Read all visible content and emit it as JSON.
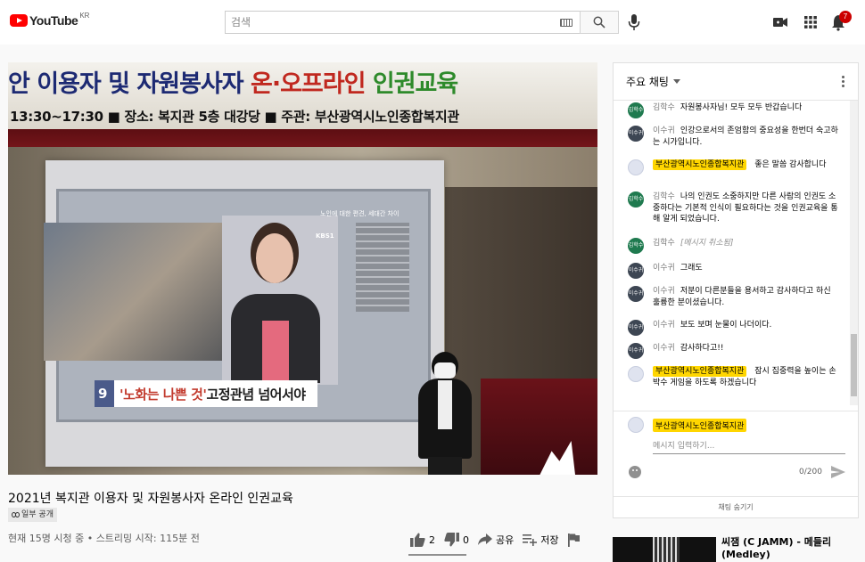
{
  "header": {
    "logo_text": "YouTube",
    "region": "KR",
    "search_placeholder": "검색",
    "notification_count": "7"
  },
  "video": {
    "banner": {
      "title_prefix": "안 이용자 및 자원봉사자 ",
      "title_red": "온·오프라인 ",
      "title_green": "인권교육",
      "subtitle": "13:30~17:30    ■ 장소: 복지관 5층 대강당    ■ 주관: 부산광역시노인종합복지관"
    },
    "tv": {
      "caption": "노인에 대한 편견, 세대간 차이",
      "channel": "KBS1",
      "lower_third_num": "9",
      "lower_third_quote": "'노화는 나쁜 것'",
      "lower_third_rest": " 고정관념 넘어서야"
    },
    "title": "2021년 복지관 이용자 및 자원봉사자 온라인 인권교육",
    "privacy": "일부 공개",
    "meta": "현재 15명 시청 중 • 스트리밍 시작: 115분 전",
    "likes": "2",
    "dislikes": "0",
    "share": "공유",
    "save": "저장",
    "like_ratio": 1.0
  },
  "chat": {
    "header": "주요 채팅",
    "messages": [
      {
        "avatar": "김학수",
        "author": "김학수",
        "text": "자원봉사자님! 모두 모두 반갑습니다"
      },
      {
        "avatar": "이수귀",
        "author": "이수귀",
        "text": "인강으로서의 존엄함의 중요성을 한번더 숙고하는 시가입니다."
      },
      {
        "avatar": "",
        "author": "부산광역시노인종합복지관",
        "text": "좋은 말씀 감사합니다"
      },
      {
        "avatar": "김학수",
        "author": "김학수",
        "text": "나의 인권도 소중하지만 다른 사람의 인권도 소중하다는 기본적 인식이 필요하다는 것을 인권교육을 통해 알게 되었습니다."
      },
      {
        "avatar": "김학수",
        "author": "김학수",
        "text": "[메시지 취소됨]"
      },
      {
        "avatar": "이수귀",
        "author": "이수귀",
        "text": "그래도"
      },
      {
        "avatar": "이수귀",
        "author": "이수귀",
        "text": "저분이 다른분들을 용서하고 감사하다고 하신 훌륭한 분이셨습니다."
      },
      {
        "avatar": "이수귀",
        "author": "이수귀",
        "text": "보도 보며 눈물이 나더이다."
      },
      {
        "avatar": "이수귀",
        "author": "이수귀",
        "text": "감사하다고!!"
      },
      {
        "avatar": "",
        "author": "부산광역시노인종합복지관",
        "text": "잠시 집중력을 높이는 손박수 게임을 하도록 하겠습니다"
      }
    ],
    "composer_name": "부산광역시노인종합복지관",
    "composer_placeholder": "메시지 입력하기...",
    "counter": "0/200",
    "hide_chat": "채팅 숨기기"
  },
  "recommendation": {
    "title": "씨잼 (C JAMM) - 메들리 (Medley)"
  }
}
